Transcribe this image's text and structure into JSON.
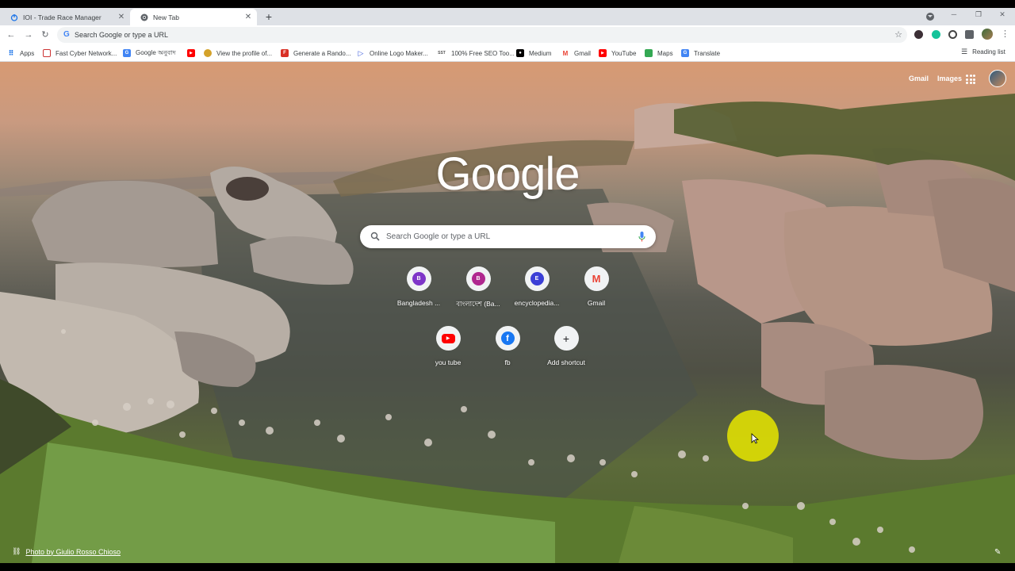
{
  "tabs": [
    {
      "title": "IOI - Trade Race Manager",
      "active": false
    },
    {
      "title": "New Tab",
      "active": true
    }
  ],
  "omnibox": {
    "placeholder": "Search Google or type a URL"
  },
  "bookmarks": [
    {
      "label": "Apps",
      "icon": "apps-grid-icon"
    },
    {
      "label": "Fast Cyber Network...",
      "icon": "fcn-icon"
    },
    {
      "label": "Google অনুবাদ",
      "icon": "google-translate-icon"
    },
    {
      "label": "",
      "icon": "youtube-icon"
    },
    {
      "label": "View the profile of...",
      "icon": "profile-icon"
    },
    {
      "label": "Generate a Rando...",
      "icon": "f-icon"
    },
    {
      "label": "Online Logo Maker...",
      "icon": "logo-maker-icon"
    },
    {
      "label": "100% Free SEO Too...",
      "icon": "sst-icon"
    },
    {
      "label": "Medium",
      "icon": "medium-icon"
    },
    {
      "label": "Gmail",
      "icon": "gmail-icon"
    },
    {
      "label": "YouTube",
      "icon": "youtube-icon"
    },
    {
      "label": "Maps",
      "icon": "maps-icon"
    },
    {
      "label": "Translate",
      "icon": "translate-icon"
    }
  ],
  "reading_list": "Reading list",
  "top_links": {
    "gmail": "Gmail",
    "images": "Images"
  },
  "logo": "Google",
  "search": {
    "placeholder": "Search Google or type a URL"
  },
  "shortcuts": [
    {
      "label": "Bangladesh ...",
      "letter": "B",
      "color": "#7e35c8"
    },
    {
      "label": "বাংলাদেশ (Ba...",
      "letter": "B",
      "color": "#b0288f"
    },
    {
      "label": "encyclopedia...",
      "letter": "E",
      "color": "#3b3fd6"
    },
    {
      "label": "Gmail",
      "letter": "M",
      "color": "#ea4335"
    },
    {
      "label": "you tube",
      "letter": "▶",
      "color": "#ff0000"
    },
    {
      "label": "fb",
      "letter": "f",
      "color": "#1877f2"
    },
    {
      "label": "Add shortcut",
      "letter": "+",
      "color": "#f1f3f4"
    }
  ],
  "credit": "Photo by Giulio Rosso Chioso"
}
